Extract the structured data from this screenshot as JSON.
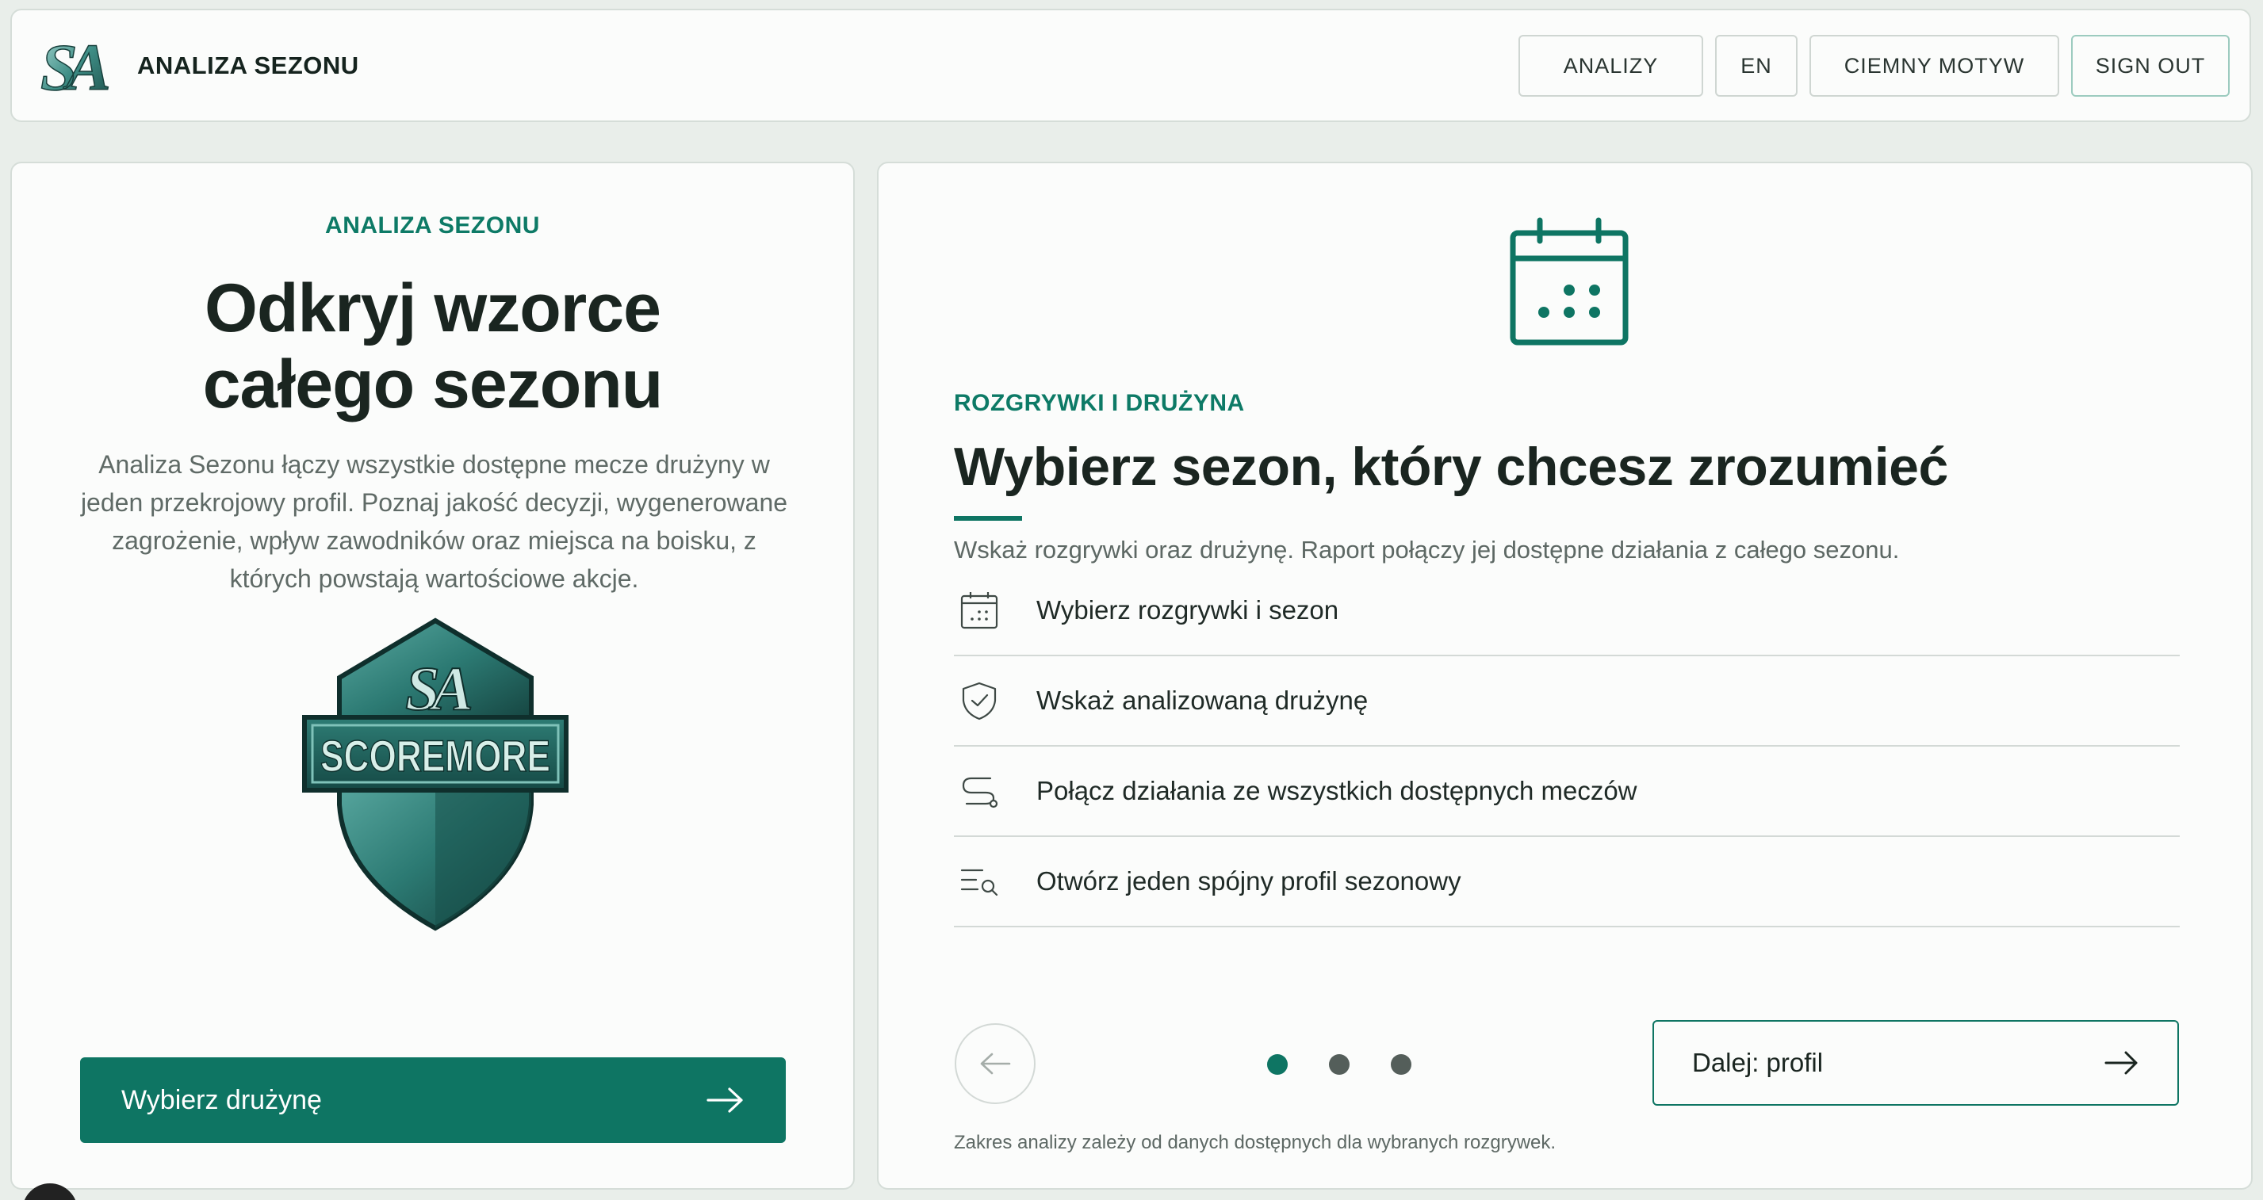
{
  "header": {
    "brand_title": "ANALIZA SEZONU",
    "logo_mark": "SA",
    "nav": {
      "analyses": "ANALIZY",
      "language": "EN",
      "dark_theme": "CIEMNY MOTYW",
      "sign_out": "SIGN OUT"
    }
  },
  "intro": {
    "eyebrow": "ANALIZA SEZONU",
    "title_line1": "Odkryj wzorce",
    "title_line2": "całego sezonu",
    "description": "Analiza Sezonu łączy wszystkie dostępne mecze drużyny w jeden przekrojowy profil. Poznaj jakość decyzji, wygenerowane zagrożenie, wpływ zawodników oraz miejsca na boisku, z których powstają wartościowe akcje.",
    "shield_mark": "SA",
    "shield_text": "SCOREMORE",
    "cta_label": "Wybierz drużynę",
    "cta_icon": "arrow-right-icon"
  },
  "wizard": {
    "hero_icon": "calendar-icon",
    "eyebrow": "ROZGRYWKI I DRUŻYNA",
    "title": "Wybierz sezon, który chcesz zrozumieć",
    "subtitle": "Wskaż rozgrywki oraz drużynę. Raport połączy jej dostępne działania z całego sezonu.",
    "steps": [
      {
        "icon": "calendar-icon",
        "label": "Wybierz rozgrywki i sezon"
      },
      {
        "icon": "shield-check-icon",
        "label": "Wskaż analizowaną drużynę"
      },
      {
        "icon": "route-icon",
        "label": "Połącz działania ze wszystkich dostępnych meczów"
      },
      {
        "icon": "list-search-icon",
        "label": "Otwórz jeden spójny profil sezonowy"
      }
    ],
    "pagination": {
      "current": 1,
      "total": 3
    },
    "next_label": "Dalej: profil",
    "footnote": "Zakres analizy zależy od danych dostępnych dla wybranych rozgrywek."
  },
  "colors": {
    "accent": "#0e7563",
    "eyebrow": "#0d7a66",
    "background": "#e9eeea",
    "card": "#fbfcfb",
    "heading": "#1a2520"
  }
}
